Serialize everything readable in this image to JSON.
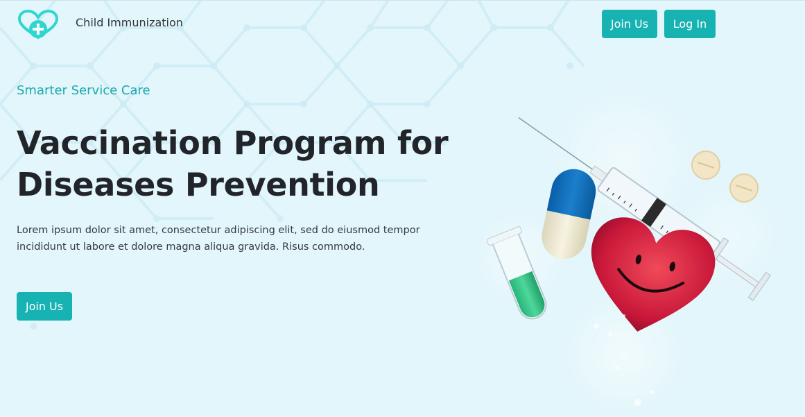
{
  "brand": {
    "name": "Child Immunization",
    "logo_icon": "heart-plus-icon",
    "color": "#2fd6d0"
  },
  "nav": {
    "join_label": "Join Us",
    "login_label": "Log In"
  },
  "hero": {
    "eyebrow": "Smarter Service Care",
    "headline_line1": "Vaccination Program for",
    "headline_line2": "Diseases Prevention",
    "paragraph_line1": "Lorem ipsum dolor sit amet, consectetur adipiscing elit, sed do eiusmod tempor",
    "paragraph_line2": "incididunt ut labore et dolore magna aliqua gravida. Risus commodo.",
    "cta_label": "Join Us"
  },
  "illustration": {
    "items": [
      "syringe-icon",
      "capsule-icon",
      "test-tube-icon",
      "pill-icon",
      "smiling-heart-icon"
    ]
  },
  "colors": {
    "accent": "#17b2b2",
    "background": "#e3f6fb",
    "headline": "#212529",
    "eyebrow": "#1aa9ad"
  }
}
